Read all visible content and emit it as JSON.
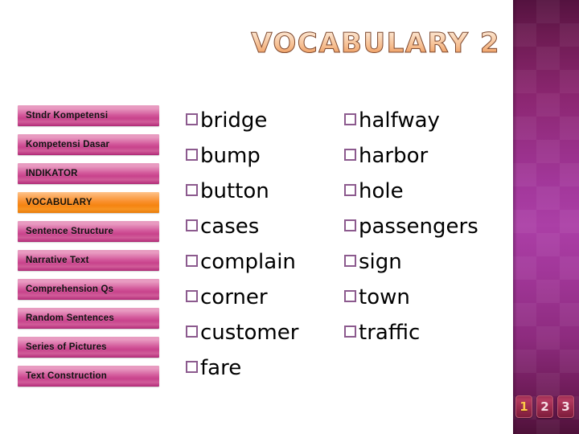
{
  "slide": {
    "title": "VOCABULARY 2",
    "title_color": "#f6bd8f",
    "background_color": "#ffffff",
    "accent_band_color": "#a2379a"
  },
  "sidebar": {
    "active_index": 3,
    "active_color": "#f58410",
    "inactive_color": "#c8438c",
    "items": [
      {
        "label": "Stndr Kompetensi"
      },
      {
        "label": "Kompetensi Dasar"
      },
      {
        "label": "INDIKATOR"
      },
      {
        "label": "VOCABULARY"
      },
      {
        "label": "Sentence Structure"
      },
      {
        "label": "Narrative Text"
      },
      {
        "label": "Comprehension Qs"
      },
      {
        "label": "Random Sentences"
      },
      {
        "label": "Series of Pictures"
      },
      {
        "label": "Text Construction"
      }
    ]
  },
  "content": {
    "bullet_glyph": "square-outline-bullet",
    "bullet_color": "#8c5a8e",
    "columns": [
      {
        "words": [
          {
            "text": "bridge"
          },
          {
            "text": "bump"
          },
          {
            "text": "button"
          },
          {
            "text": "cases"
          },
          {
            "text": "complain"
          },
          {
            "text": "corner"
          },
          {
            "text": "customer"
          },
          {
            "text": "fare"
          }
        ]
      },
      {
        "words": [
          {
            "text": "halfway"
          },
          {
            "text": "harbor"
          },
          {
            "text": "hole"
          },
          {
            "text": "passengers"
          },
          {
            "text": "sign"
          },
          {
            "text": "town"
          },
          {
            "text": "traffic"
          }
        ]
      }
    ]
  },
  "pagination": {
    "current": "1",
    "pages": [
      {
        "number": "1"
      },
      {
        "number": "2"
      },
      {
        "number": "3"
      }
    ]
  }
}
